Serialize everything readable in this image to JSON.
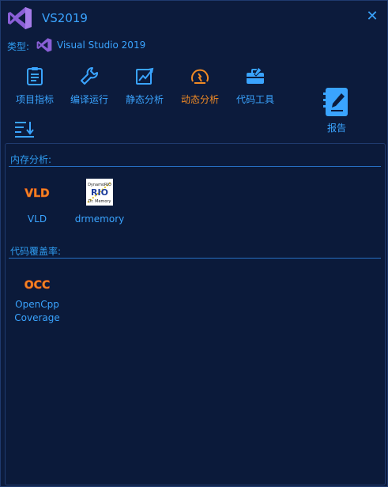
{
  "window": {
    "title": "VS2019",
    "close_symbol": "✕"
  },
  "type_row": {
    "label": "类型:",
    "value": "Visual Studio 2019"
  },
  "toolbar": [
    {
      "label": "项目指标",
      "icon": "clipboard-icon"
    },
    {
      "label": "编译运行",
      "icon": "wrench-icon"
    },
    {
      "label": "静态分析",
      "icon": "trend-chart-icon"
    },
    {
      "label": "动态分析",
      "icon": "gauge-icon",
      "active": true
    },
    {
      "label": "代码工具",
      "icon": "toolbox-icon"
    }
  ],
  "report": {
    "label": "报告",
    "icon": "report-notebook-icon"
  },
  "sections": [
    {
      "title": "内存分析:",
      "items": [
        {
          "label": "VLD",
          "logo_text": "VLD"
        },
        {
          "label": "drmemory",
          "logo_lines": [
            "DynamoRIO",
            "RIO",
            "Dr. Memory"
          ]
        }
      ]
    },
    {
      "title": "代码覆盖率:",
      "items": [
        {
          "label_lines": [
            "OpenCpp",
            "Coverage"
          ],
          "logo_text": "OCC"
        }
      ]
    }
  ],
  "colors": {
    "background": "#0b1a3a",
    "accent": "#3aa4ff",
    "active": "#f08a24",
    "logo_purple": "#8a5fd6"
  }
}
